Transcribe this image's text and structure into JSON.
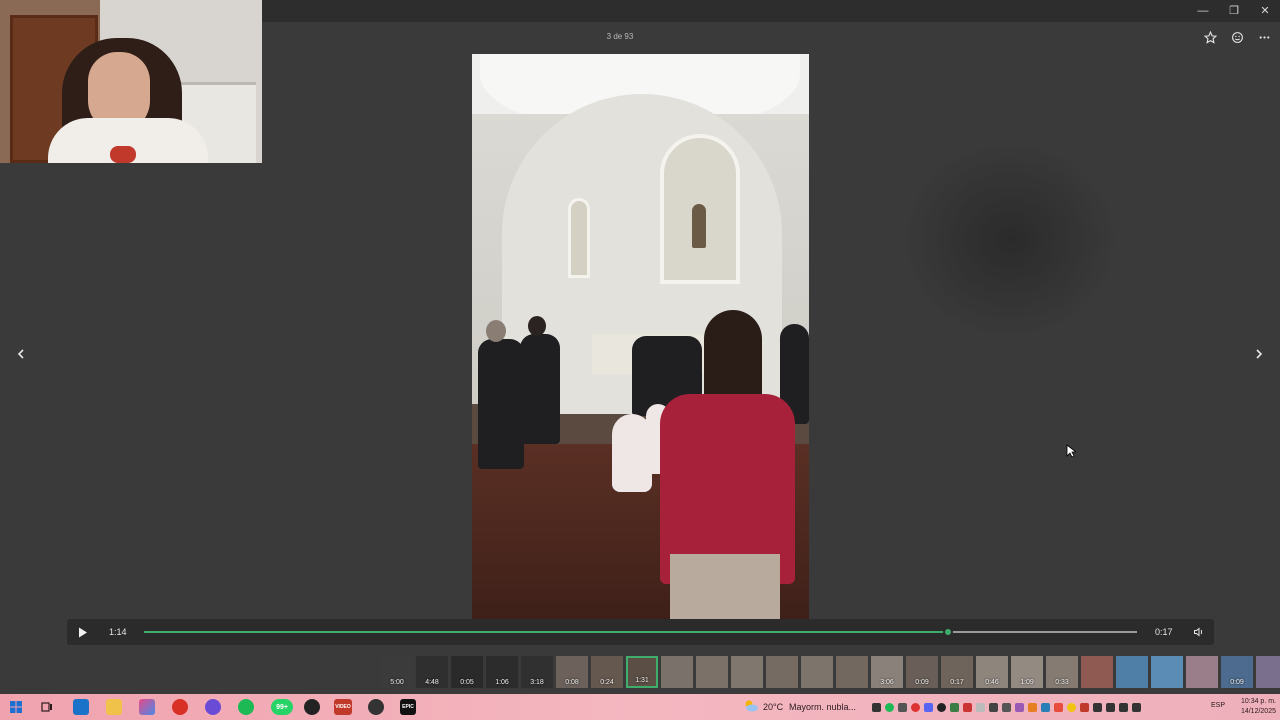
{
  "viewer": {
    "counter": "3 de 93",
    "window_controls": {
      "minimize": "—",
      "maximize": "❐",
      "close": "✕"
    },
    "top_tools": [
      "star-icon",
      "smiley-icon",
      "more-icon"
    ]
  },
  "player": {
    "current_time": "1:14",
    "duration": "0:17",
    "progress": 0.81,
    "accent": "#3fae6a"
  },
  "filmstrip": {
    "items": [
      {
        "dur": "5:00",
        "color": "#3c3b3b"
      },
      {
        "dur": "4:48",
        "color": "#2f2f2f"
      },
      {
        "dur": "0:05",
        "color": "#2a2a2a"
      },
      {
        "dur": "1:06",
        "color": "#2c2c2c"
      },
      {
        "dur": "3:18",
        "color": "#303030"
      },
      {
        "dur": "0:08",
        "color": "#6c615b"
      },
      {
        "dur": "0:24",
        "color": "#65584f"
      },
      {
        "dur": "1:31",
        "color": "#5a4e45",
        "selected": true
      },
      {
        "dur": "",
        "color": "#7a716a"
      },
      {
        "dur": "",
        "color": "#7b7169"
      },
      {
        "dur": "",
        "color": "#80776f"
      },
      {
        "dur": "",
        "color": "#756b63"
      },
      {
        "dur": "",
        "color": "#7d746c"
      },
      {
        "dur": "",
        "color": "#736860"
      },
      {
        "dur": "3:06",
        "color": "#8a817a"
      },
      {
        "dur": "0:09",
        "color": "#6a5f58"
      },
      {
        "dur": "0:17",
        "color": "#6f645c"
      },
      {
        "dur": "0:46",
        "color": "#8e857d"
      },
      {
        "dur": "1:09",
        "color": "#938a82"
      },
      {
        "dur": "0:33",
        "color": "#857b73"
      },
      {
        "dur": "",
        "color": "#8f5a52"
      },
      {
        "dur": "",
        "color": "#4f7ea6"
      },
      {
        "dur": "",
        "color": "#5b8cb6"
      },
      {
        "dur": "",
        "color": "#9a7f8a"
      },
      {
        "dur": "0:09",
        "color": "#4c6b8f"
      },
      {
        "dur": "",
        "color": "#7b6f8e"
      }
    ]
  },
  "taskbar": {
    "weather_temp": "20°C",
    "weather_desc": "Mayorm. nubla...",
    "language": "ESP",
    "time": "10:34 p. m.",
    "date": "14/12/2025",
    "badge": "99+",
    "epic_label": "EPIC",
    "video_label": "VIDEO"
  }
}
